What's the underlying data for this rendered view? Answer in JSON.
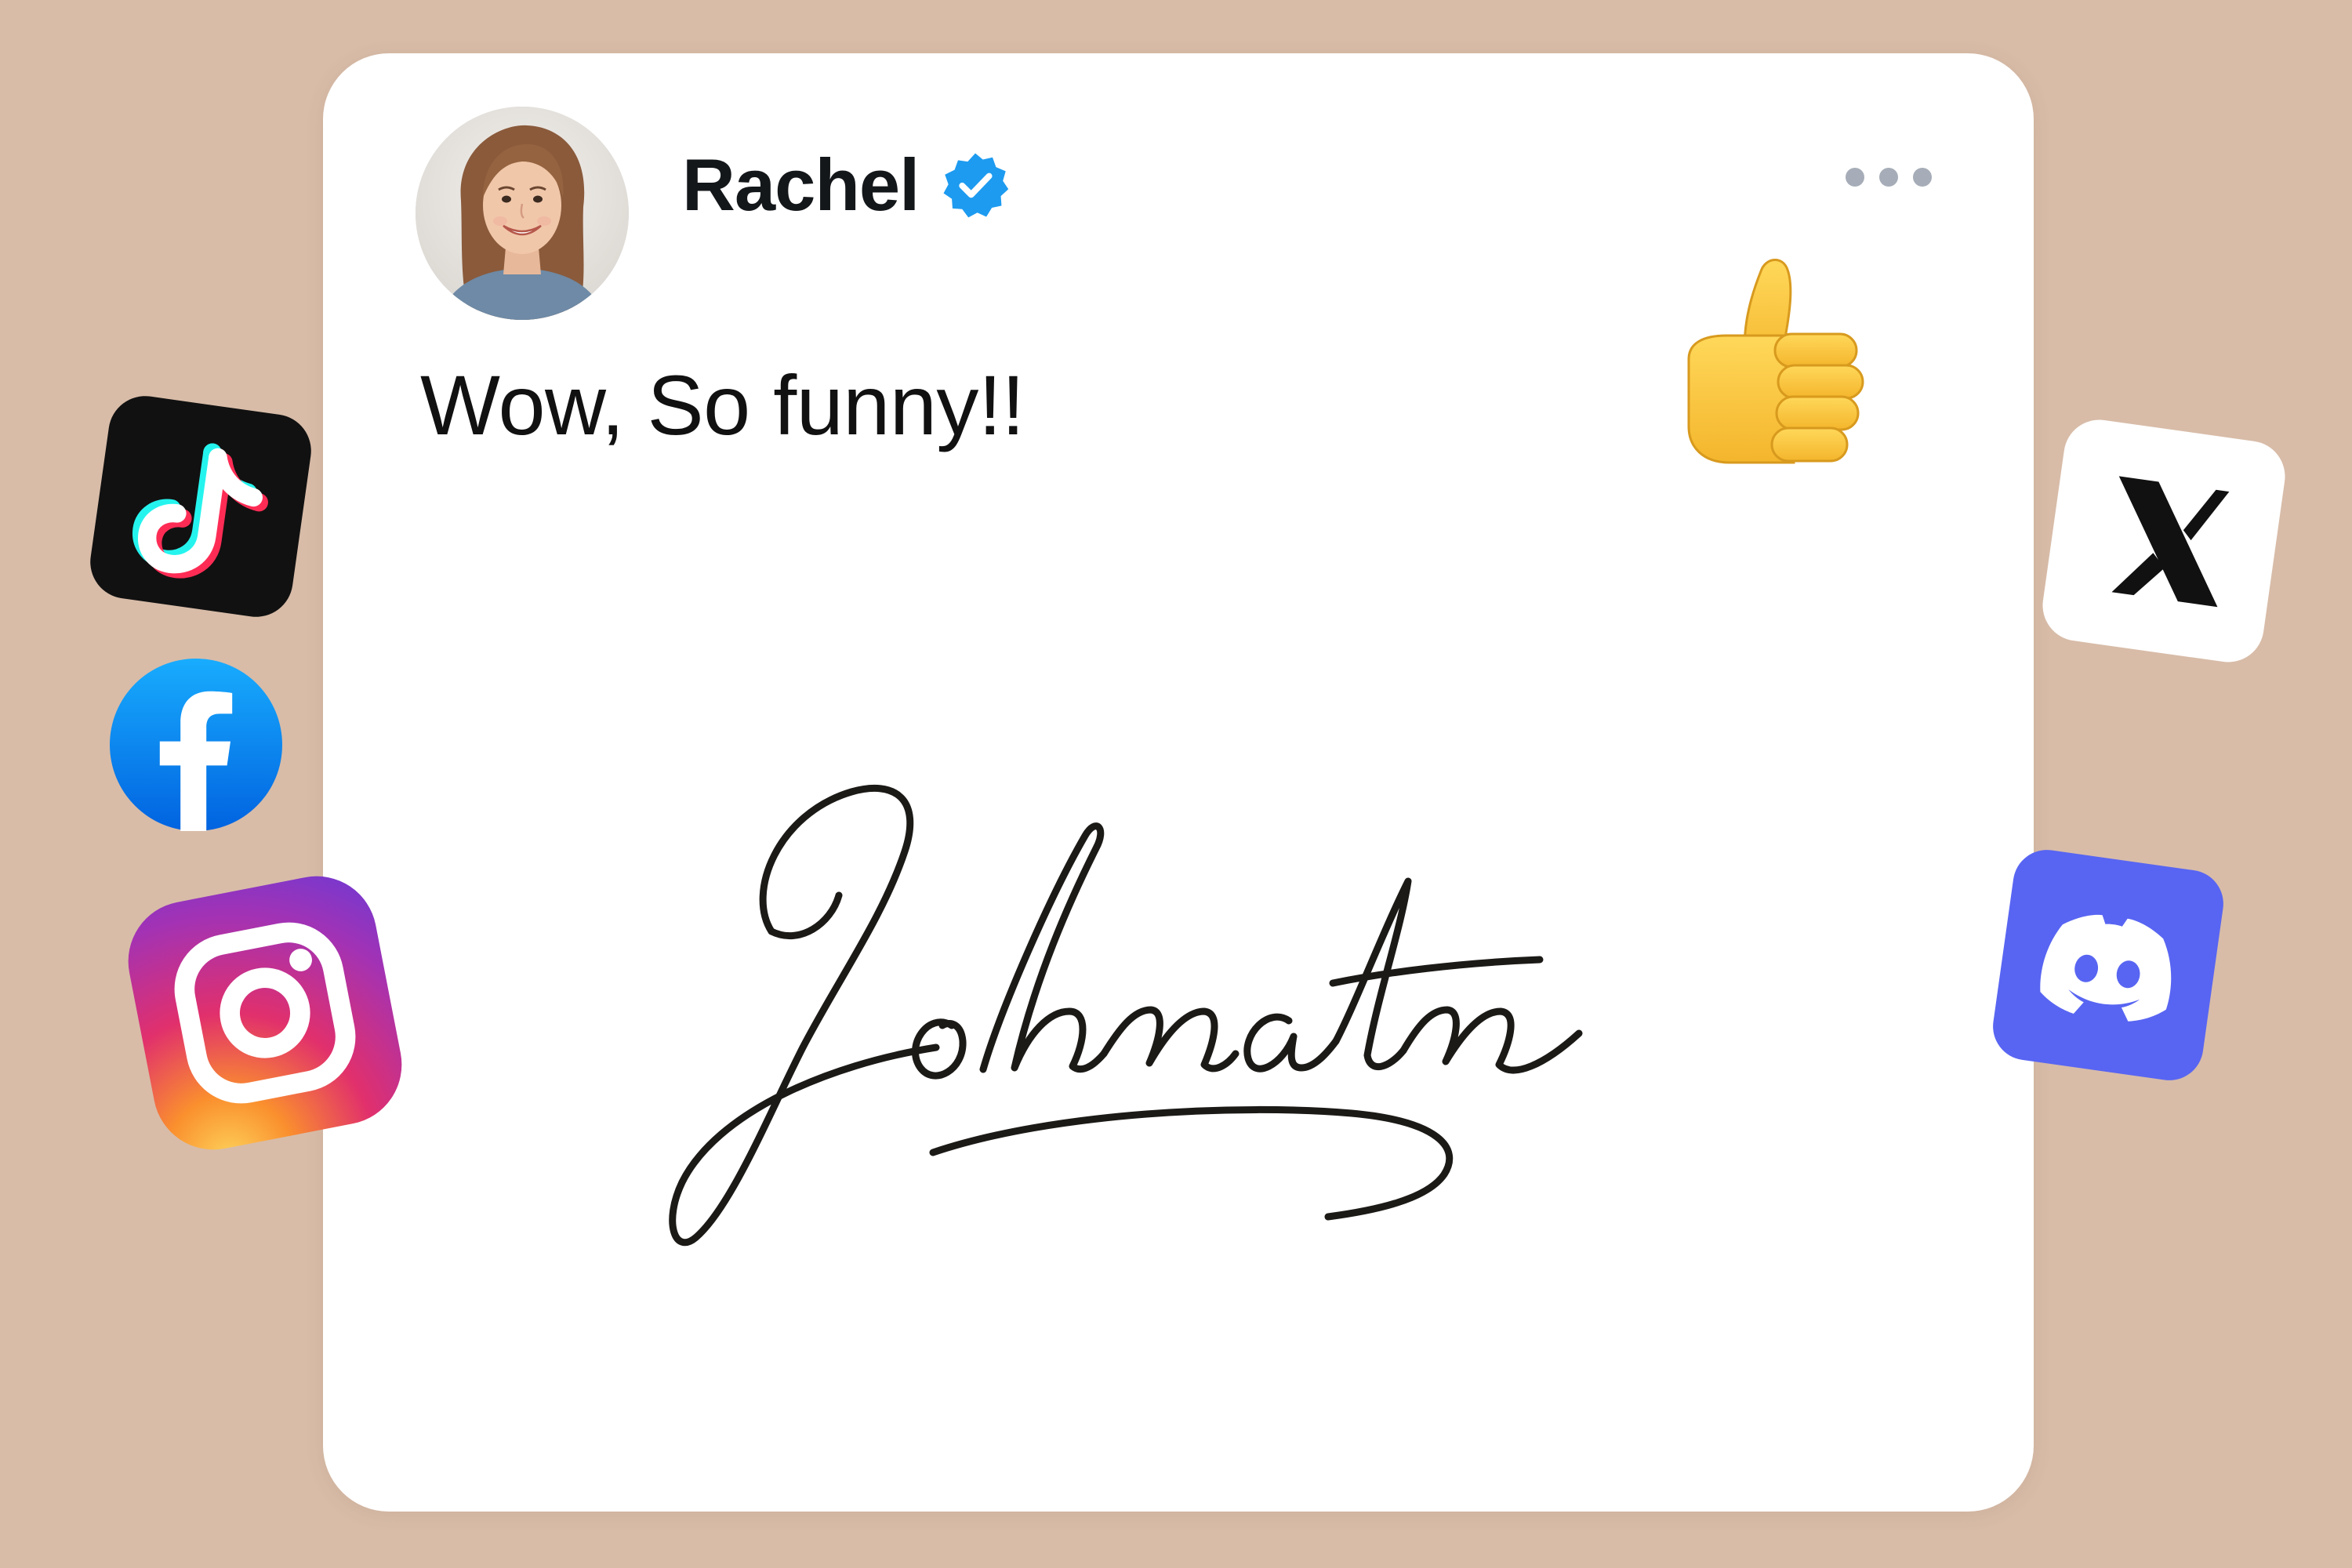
{
  "post": {
    "username": "Rachel",
    "verified": true,
    "text": "Wow, So funny!!",
    "reaction_icon": "thumbs-up-icon",
    "signature": "Johnatn"
  },
  "icons": {
    "verified": "verified-badge-icon",
    "more": "more-options-icon",
    "social": [
      "tiktok-icon",
      "facebook-icon",
      "instagram-icon",
      "x-icon",
      "discord-icon"
    ]
  },
  "colors": {
    "background": "#d8bca8",
    "card": "#ffffff",
    "verified_blue": "#1d9bf0",
    "text": "#14171a",
    "facebook": "#1877f2",
    "discord": "#5865f2",
    "tiktok": "#111111",
    "x_tile": "#ffffff"
  }
}
